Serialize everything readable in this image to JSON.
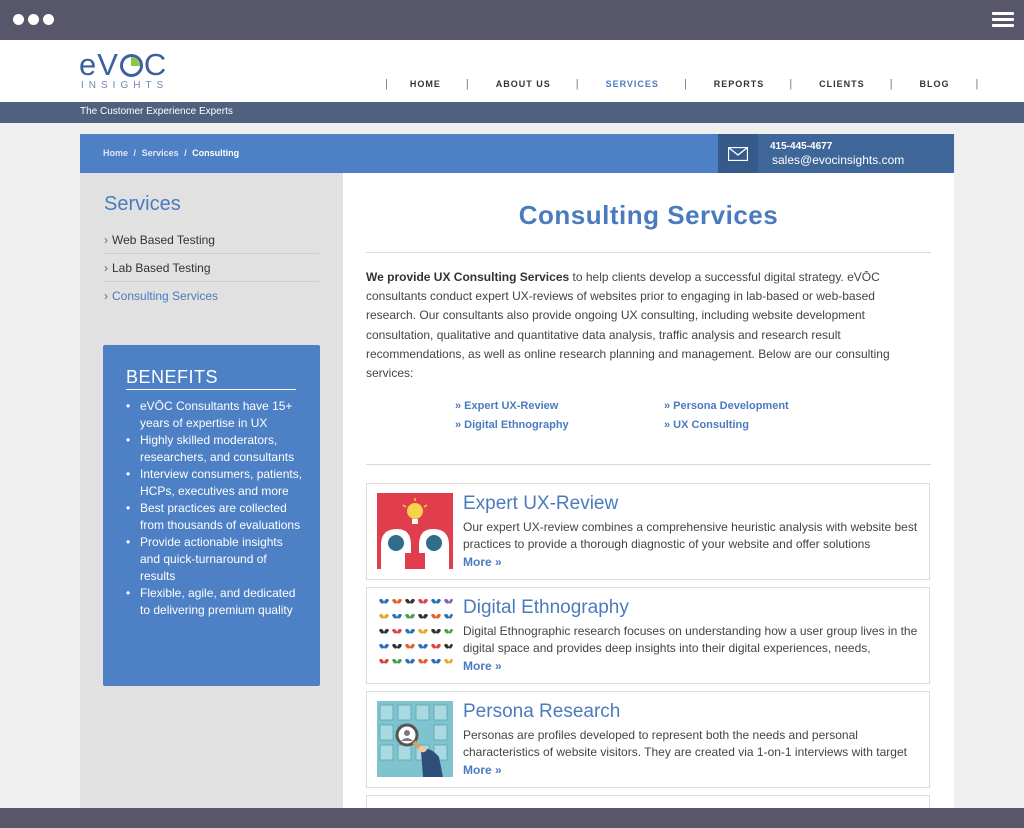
{
  "header": {
    "logo_text": "eVŌC",
    "logo_sub": "INSIGHTS",
    "tagline": "The Customer Experience Experts",
    "nav": [
      {
        "label": "HOME",
        "active": false
      },
      {
        "label": "ABOUT US",
        "active": false
      },
      {
        "label": "SERVICES",
        "active": true
      },
      {
        "label": "REPORTS",
        "active": false
      },
      {
        "label": "CLIENTS",
        "active": false
      },
      {
        "label": "BLOG",
        "active": false
      }
    ]
  },
  "breadcrumb": {
    "items": [
      "Home",
      "Services",
      "Consulting"
    ],
    "separator": "/"
  },
  "contact": {
    "phone": "415-445-4677",
    "email": "sales@evocinsights.com"
  },
  "sidebar": {
    "title": "Services",
    "items": [
      {
        "label": "Web Based Testing",
        "active": false
      },
      {
        "label": "Lab Based Testing",
        "active": false
      },
      {
        "label": "Consulting Services",
        "active": true
      }
    ],
    "benefits_title": "BENEFITS",
    "benefits": [
      "eVŌC Consultants have 15+ years of expertise in UX",
      "Highly skilled moderators, researchers, and consultants",
      "Interview consumers, patients, HCPs, executives and more",
      "Best practices are collected from thousands of evaluations",
      "Provide actionable insights and quick-turnaround of results",
      "Flexible, agile, and dedicated to delivering premium quality"
    ]
  },
  "main": {
    "title": "Consulting Services",
    "intro_bold": "We provide UX Consulting Services",
    "intro_rest": " to help clients develop a successful digital strategy. eVŌC consultants conduct expert UX-reviews of websites prior to engaging in lab-based or web-based research. Our consultants also provide ongoing UX consulting, including website development consultation, qualitative and quantitative data analysis, traffic analysis and research result recommendations, as well as online research planning and management. Below are our consulting services:",
    "links": [
      "» Expert UX-Review",
      "» Persona Development",
      "» Digital Ethnography",
      "» UX Consulting"
    ],
    "cards": [
      {
        "title": "Expert UX-Review",
        "desc": "Our expert UX-review combines a comprehensive heuristic analysis with website best practices to provide a thorough diagnostic of your website and offer solutions",
        "more": "More »"
      },
      {
        "title": "Digital Ethnography",
        "desc": "Digital Ethnographic research focuses on understanding how a user group lives in the digital space and provides deep insights into their digital experiences, needs,",
        "more": "More »"
      },
      {
        "title": "Persona Research",
        "desc": "Personas are profiles developed to represent both the needs and personal characteristics of website visitors. They are created via 1-on-1 interviews with target",
        "more": "More »"
      }
    ]
  },
  "colors": {
    "brand_blue": "#4d80c4",
    "link_blue": "#4a7bbf",
    "dark_bar": "#4f617f",
    "chrome": "#57566a",
    "logo_green": "#8dc63f"
  }
}
